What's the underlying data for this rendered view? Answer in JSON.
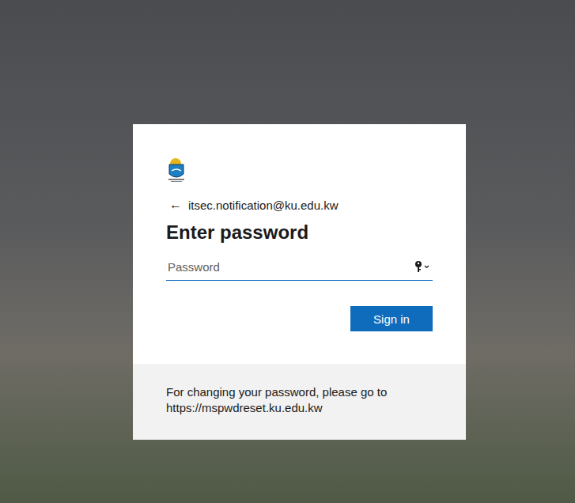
{
  "account": {
    "back_icon": "←",
    "email": "itsec.notification@ku.edu.kw"
  },
  "title": "Enter password",
  "password": {
    "placeholder": "Password"
  },
  "buttons": {
    "sign_in": "Sign in"
  },
  "footer": {
    "text": "For changing your password, please go to https://mspwdreset.ku.edu.kw"
  }
}
